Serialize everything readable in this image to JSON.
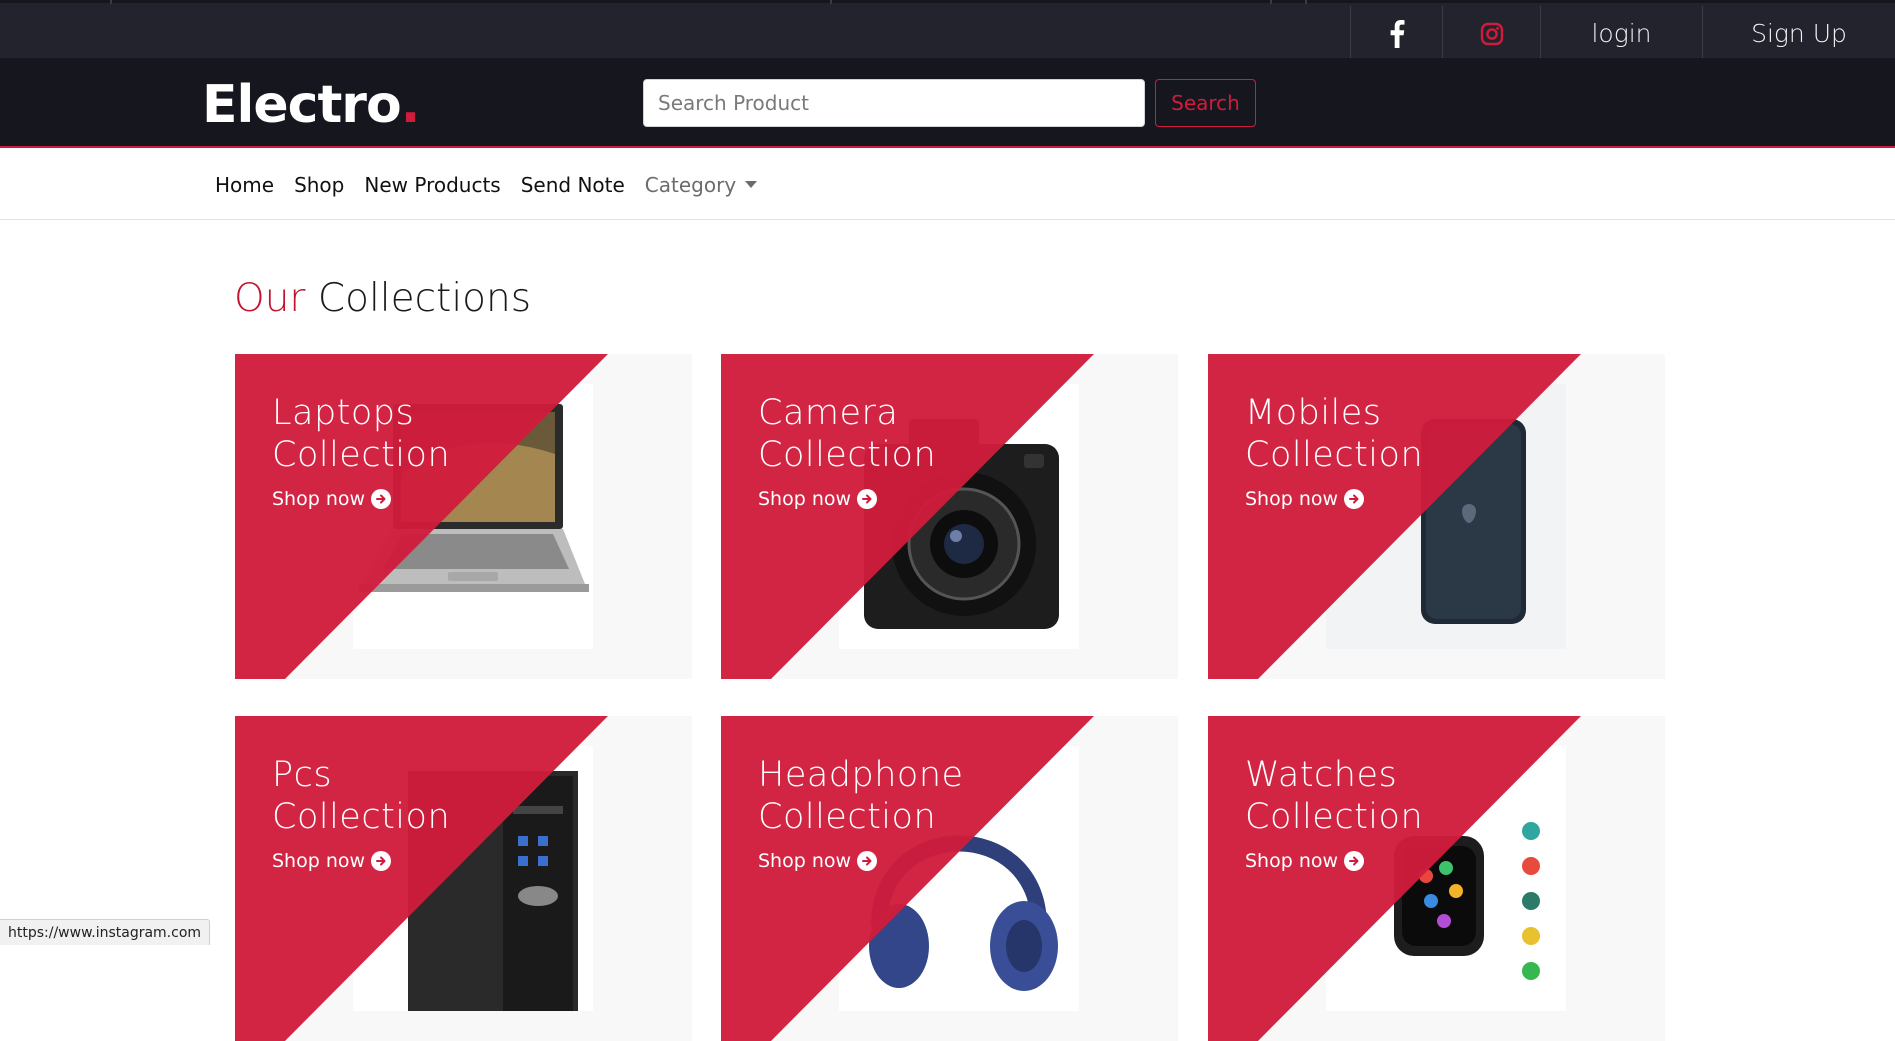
{
  "top_bar": {
    "social": [
      {
        "name": "facebook-icon",
        "color": "#ffffff"
      },
      {
        "name": "instagram-icon",
        "color": "#d01c3c"
      }
    ],
    "login_label": "login",
    "signup_label": "Sign Up"
  },
  "header": {
    "logo_text": "Electro",
    "logo_dot": ".",
    "search_placeholder": "Search Product",
    "search_button": "Search"
  },
  "nav": {
    "items": [
      "Home",
      "Shop",
      "New Products",
      "Send Note",
      "Category"
    ]
  },
  "collections": {
    "title_accent": "Our",
    "title_rest": "Collections",
    "cards": [
      {
        "title_line1": "Laptops",
        "title_line2": "Collection",
        "cta": "Shop now"
      },
      {
        "title_line1": "Camera",
        "title_line2": "Collection",
        "cta": "Shop now"
      },
      {
        "title_line1": "Mobiles",
        "title_line2": "Collection",
        "cta": "Shop now"
      },
      {
        "title_line1": "Pcs",
        "title_line2": "Collection",
        "cta": "Shop now"
      },
      {
        "title_line1": "Headphone",
        "title_line2": "Collection",
        "cta": "Shop now"
      },
      {
        "title_line1": "Watches",
        "title_line2": "Collection",
        "cta": "Shop now"
      }
    ]
  },
  "status_bar": {
    "url": "https://www.instagram.com"
  },
  "colors": {
    "accent": "#d01c3c",
    "dark_bar": "#22232d",
    "header_bg": "#16161f"
  }
}
